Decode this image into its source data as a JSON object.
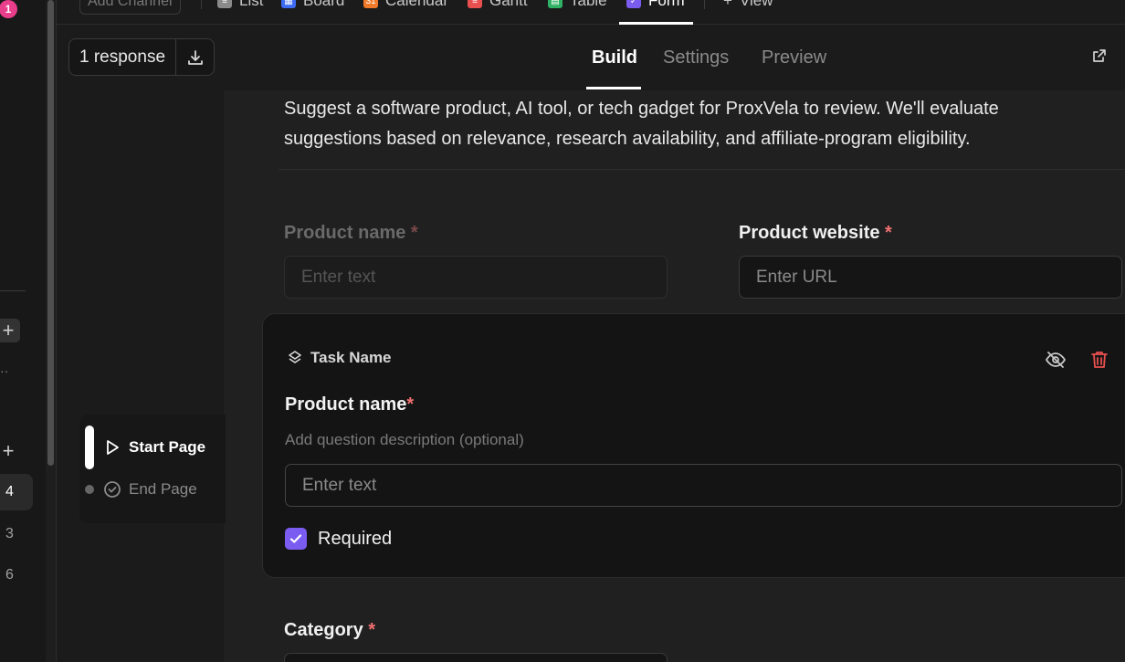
{
  "rail": {
    "badge": "1",
    "numbers": [
      "4",
      "3",
      "6"
    ]
  },
  "viewbar": {
    "add_channel": "Add Channel",
    "tabs": [
      {
        "label": "List",
        "color": "#8a8a8a"
      },
      {
        "label": "Board",
        "color": "#3d6bf2"
      },
      {
        "label": "Calendar",
        "color": "#f07a2a",
        "icon_text": "31"
      },
      {
        "label": "Gantt",
        "color": "#e8504f"
      },
      {
        "label": "Table",
        "color": "#2fb164"
      },
      {
        "label": "Form",
        "color": "#7b5cf0"
      }
    ],
    "add_view": "View"
  },
  "header": {
    "responses": "1 response",
    "tabs": [
      "Build",
      "Settings",
      "Preview"
    ],
    "active_tab": "Build"
  },
  "outline": {
    "start_page": "Start Page",
    "end_page": "End Page"
  },
  "form": {
    "description": "Suggest a software product, AI tool, or tech gadget for ProxVela to review. We'll evaluate suggestions based on relevance, research availability, and affiliate-program eligibility.",
    "fields": [
      {
        "label": "Product name",
        "placeholder": "Enter text"
      },
      {
        "label": "Product website",
        "placeholder": "Enter URL"
      }
    ],
    "card": {
      "mapping": "Task Name",
      "title": "Product name",
      "description_placeholder": "Add question description (optional)",
      "placeholder": "Enter text",
      "required_label": "Required",
      "required": true
    },
    "next_field": {
      "label": "Category"
    }
  },
  "colors": {
    "accent": "#7b5cf0",
    "required_star": "#f07070",
    "delete": "#e8504f"
  }
}
